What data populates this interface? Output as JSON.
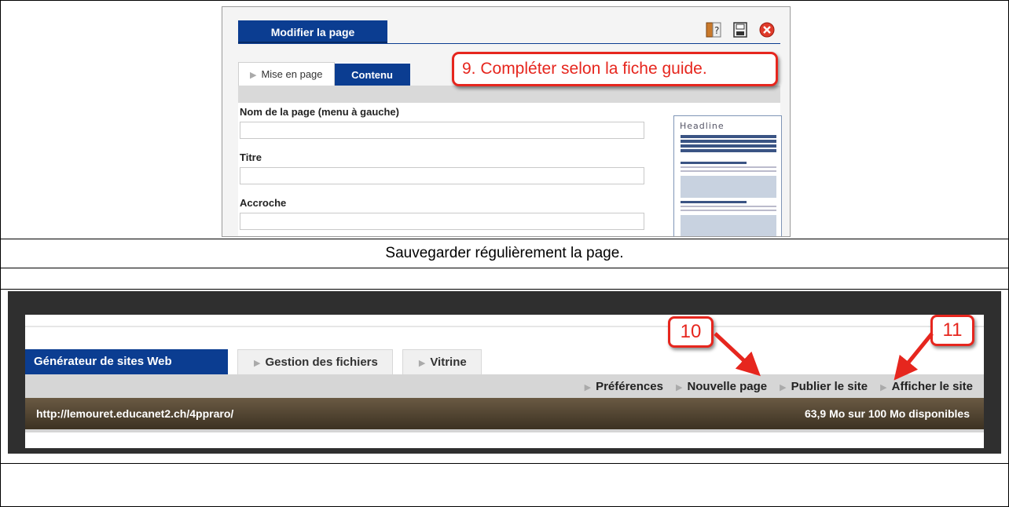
{
  "editor": {
    "title_tab": "Modifier la page",
    "tabs": [
      {
        "label": "Mise en page"
      },
      {
        "label": "Contenu"
      }
    ],
    "fields": [
      {
        "label": "Nom de la page (menu à gauche)",
        "value": ""
      },
      {
        "label": "Titre",
        "value": ""
      },
      {
        "label": "Accroche",
        "value": ""
      }
    ],
    "preview_title": "Headline",
    "callout": "9. Compléter selon la fiche guide.",
    "icons": [
      "help-icon",
      "save-icon",
      "close-icon"
    ]
  },
  "caption": "Sauvegarder régulièrement la page.",
  "generator": {
    "tabs": [
      {
        "label": "Générateur de sites Web"
      },
      {
        "label": "Gestion des fichiers"
      },
      {
        "label": "Vitrine"
      }
    ],
    "actions": [
      {
        "label": "Préférences"
      },
      {
        "label": "Nouvelle page"
      },
      {
        "label": "Publier le site"
      },
      {
        "label": "Afficher le site"
      }
    ],
    "url": "http://lemouret.educanet2.ch/4ppraro/",
    "quota": "63,9 Mo sur 100 Mo disponibles",
    "callouts": [
      "10",
      "11"
    ]
  },
  "colors": {
    "accent_blue": "#0b3d91",
    "callout_red": "#e6261e",
    "url_bar_brown": "#5a4a35"
  }
}
